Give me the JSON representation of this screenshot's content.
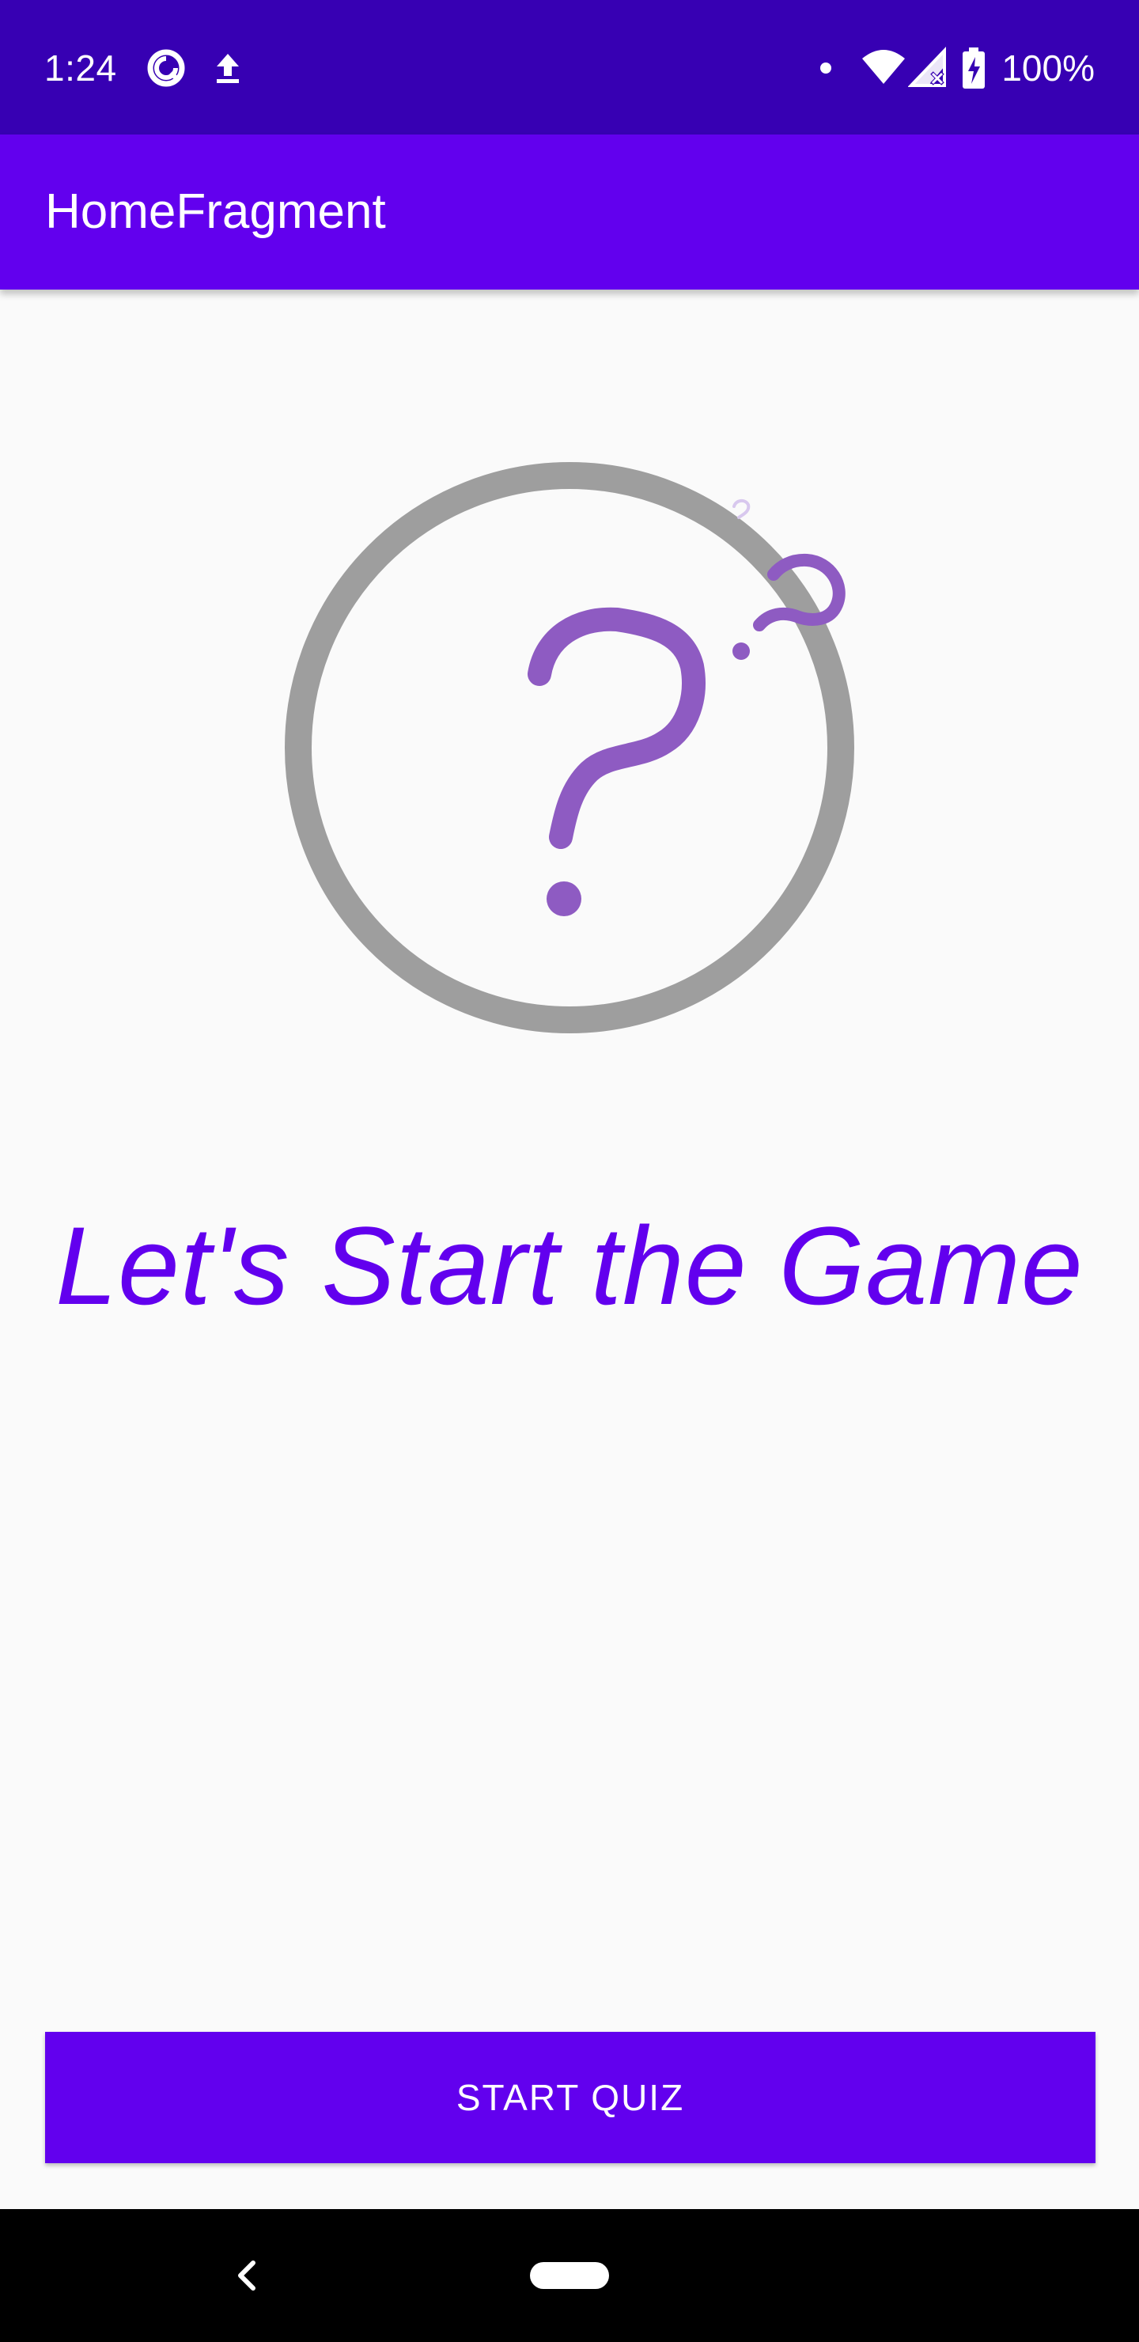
{
  "status_bar": {
    "time": "1:24",
    "battery_percent": "100%",
    "icons": [
      "data-saver-icon",
      "upload-icon",
      "notification-dot-icon",
      "wifi-icon",
      "signal-no-data-icon",
      "battery-charging-icon"
    ]
  },
  "app_bar": {
    "title": "HomeFragment"
  },
  "illustration": {
    "icon": "question-mark-circle-icon",
    "colors": {
      "circle": "#9E9E9E",
      "question": "#8E5BC2"
    }
  },
  "main": {
    "headline": "Let's Start the Game"
  },
  "start_button": {
    "label": "START QUIZ"
  },
  "nav_bar": {
    "icons": [
      "back-icon",
      "home-pill-icon"
    ]
  },
  "theme": {
    "primary": "#6200EE",
    "primary_dark": "#3700B3",
    "background": "#FAFAFA"
  }
}
